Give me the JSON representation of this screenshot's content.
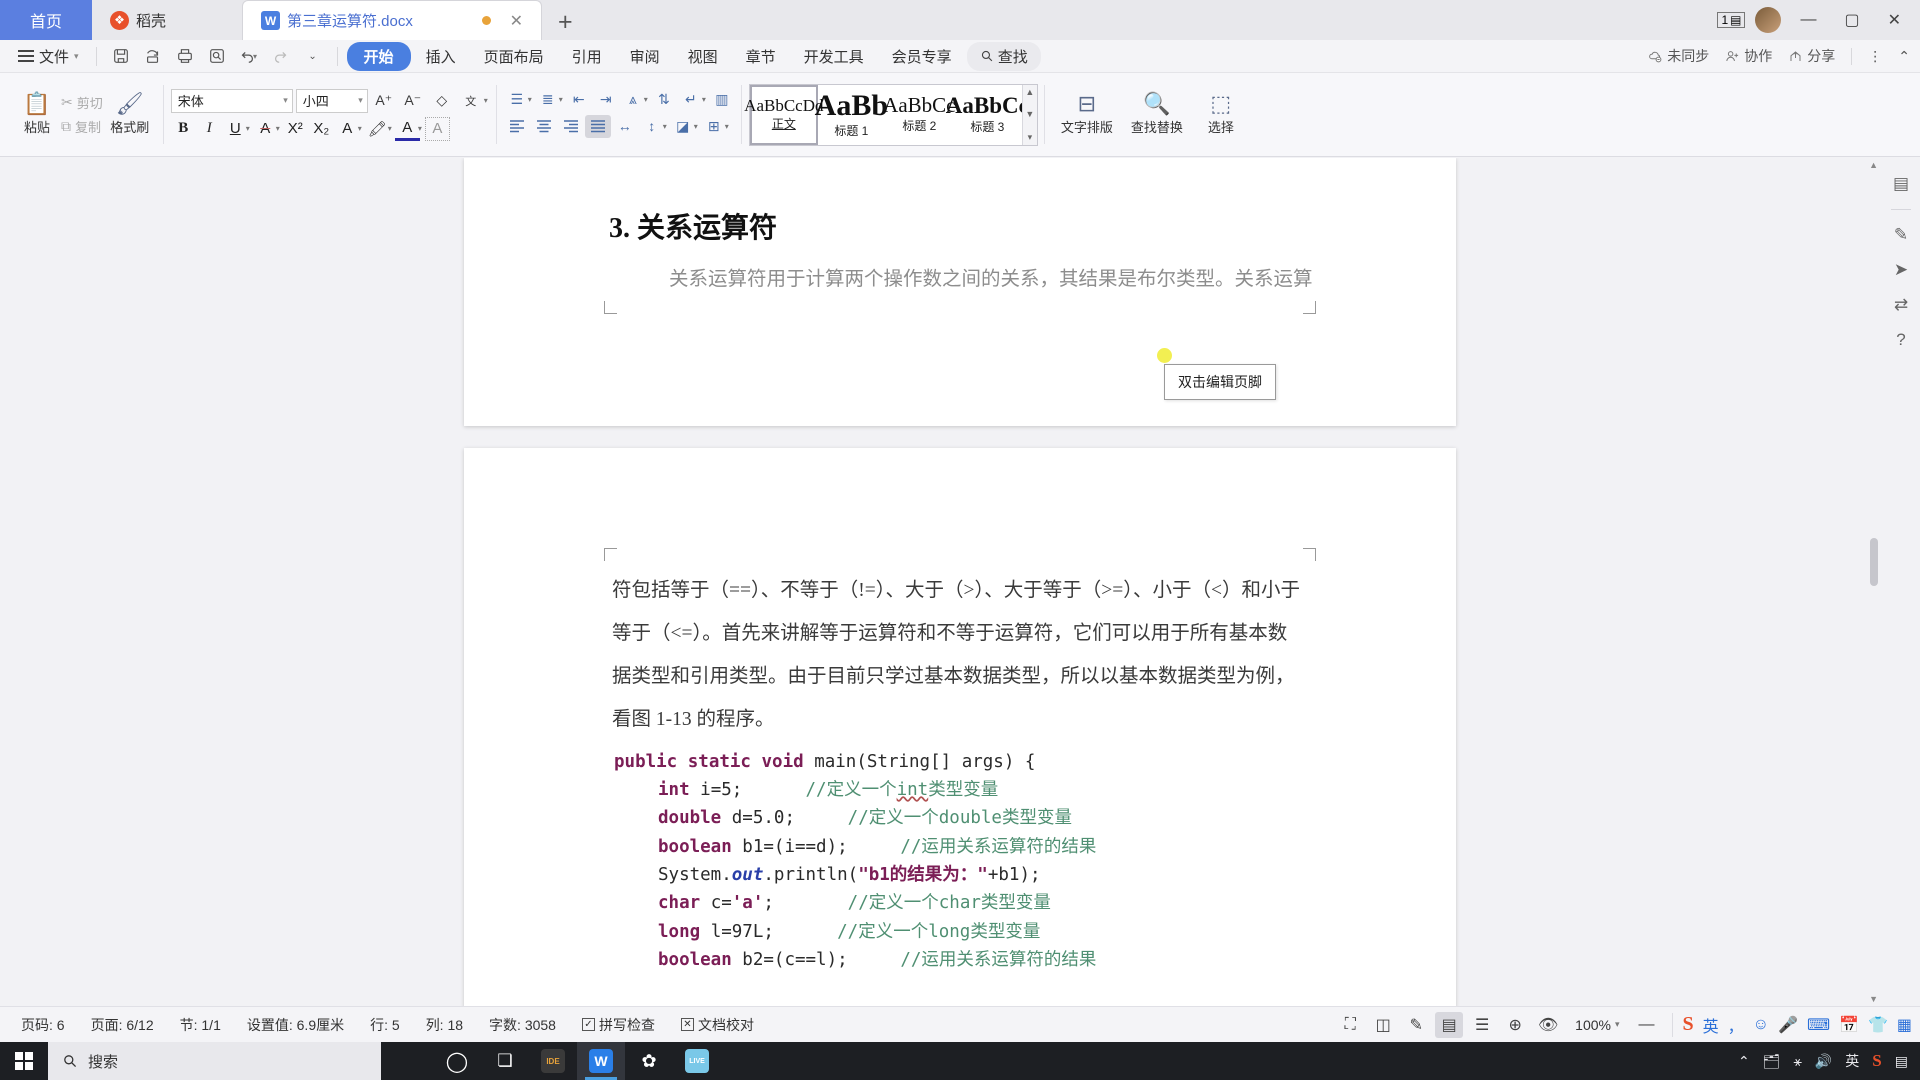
{
  "window": {
    "tabs": [
      {
        "label": "首页",
        "icon": "home-tab"
      },
      {
        "label": "稻壳",
        "icon": "daoke-icon"
      },
      {
        "label": "第三章运算符.docx",
        "icon": "word-doc-icon"
      }
    ],
    "new_tab": "+",
    "badge": "1",
    "minimize": "—",
    "maximize": "▢",
    "close": "✕"
  },
  "menubar": {
    "file": "文件",
    "quick_icons": [
      "save-icon",
      "print-preview-icon",
      "print-icon",
      "find-doc-icon",
      "undo-icon",
      "redo-icon",
      "customize-icon"
    ],
    "tabs": [
      "开始",
      "插入",
      "页面布局",
      "引用",
      "审阅",
      "视图",
      "章节",
      "开发工具",
      "会员专享"
    ],
    "active_tab": "开始",
    "find": "查找",
    "right": {
      "sync": "未同步",
      "collaborate": "协作",
      "share": "分享",
      "more": "⋮",
      "collapse": "⌃"
    }
  },
  "ribbon": {
    "clipboard": {
      "paste": "粘贴",
      "cut": "剪切",
      "copy": "复制",
      "format_painter": "格式刷"
    },
    "font": {
      "family": "宋体",
      "size": "小四",
      "grow": "A⁺",
      "shrink": "A⁻",
      "clear_format": "clear-format-icon",
      "pinyin": "拼音指南",
      "bold": "B",
      "italic": "I",
      "underline": "U",
      "strikethrough": "A",
      "superscript": "X²",
      "subscript": "X₂",
      "char_border": "A",
      "highlight": "highlight-icon",
      "font_color": "A",
      "char_shading": "char-shading-icon"
    },
    "paragraph": {
      "bullets": "bullet-list-icon",
      "numbering": "numbered-list-icon",
      "decrease_indent": "decrease-indent-icon",
      "increase_indent": "increase-indent-icon",
      "smart_layout": "smart-layout-icon",
      "sort": "sort-icon",
      "show_marks": "show-marks-icon",
      "ruler": "ruler-icon",
      "align_left": "align-left-icon",
      "align_center": "align-center-icon",
      "align_right": "align-right-icon",
      "align_justify": "align-justify-icon",
      "distribute": "distribute-icon",
      "line_spacing": "line-spacing-icon",
      "shading": "shading-icon",
      "borders": "borders-icon",
      "active": "align-justify-icon"
    },
    "styles": [
      {
        "preview": "AaBbCcDd",
        "label": "正文",
        "size": 17,
        "selected": true
      },
      {
        "preview": "AaBb",
        "label": "标题 1",
        "size": 30,
        "bold": true,
        "selected": false
      },
      {
        "preview": "AaBbCc",
        "label": "标题 2",
        "size": 21,
        "selected": false
      },
      {
        "preview": "AaBbCc",
        "label": "标题 3",
        "size": 23,
        "bold": true,
        "selected": false
      }
    ],
    "tools": {
      "text_layout": "文字排版",
      "find_replace": "查找替换",
      "select": "选择"
    }
  },
  "document": {
    "heading": "3. 关系运算符",
    "page1_paragraph": "关系运算符用于计算两个操作数之间的关系，其结果是布尔类型。关系运算",
    "footer_tooltip": "双击编辑页脚",
    "page2_paragraphs": [
      "符包括等于（==）、不等于（!=）、大于（>）、大于等于（>=）、小于（<）和小于",
      "等于（<=）。首先来讲解等于运算符和不等于运算符，它们可以用于所有基本数",
      "据类型和引用类型。由于目前只学过基本数据类型，所以以基本数据类型为例，",
      "看图 1-13 的程序。"
    ],
    "code_lines": [
      {
        "indent": 0,
        "tokens": [
          {
            "t": "public static void ",
            "c": "kw"
          },
          {
            "t": "main(String[] args) {",
            "c": "ident"
          }
        ]
      },
      {
        "indent": 1,
        "tokens": [
          {
            "t": "int ",
            "c": "kw"
          },
          {
            "t": "i=5;      ",
            "c": "ident"
          },
          {
            "t": "//定义一个",
            "c": "cm"
          },
          {
            "t": "int",
            "c": "cm-sq"
          },
          {
            "t": "类型变量",
            "c": "cm"
          }
        ]
      },
      {
        "indent": 1,
        "tokens": [
          {
            "t": "double ",
            "c": "kw"
          },
          {
            "t": "d=5.0;     ",
            "c": "ident"
          },
          {
            "t": "//定义一个double类型变量",
            "c": "cm"
          }
        ]
      },
      {
        "indent": 1,
        "tokens": [
          {
            "t": "boolean ",
            "c": "kw"
          },
          {
            "t": "b1=(i==d);     ",
            "c": "ident"
          },
          {
            "t": "//运用关系运算符的结果",
            "c": "cm"
          }
        ]
      },
      {
        "indent": 1,
        "tokens": [
          {
            "t": "System.",
            "c": "ident"
          },
          {
            "t": "out",
            "c": "ital"
          },
          {
            "t": ".println(",
            "c": "ident"
          },
          {
            "t": "\"b1的结果为：\"",
            "c": "str"
          },
          {
            "t": "+b1);",
            "c": "ident"
          }
        ]
      },
      {
        "indent": 1,
        "tokens": [
          {
            "t": "char ",
            "c": "kw"
          },
          {
            "t": "c=",
            "c": "ident"
          },
          {
            "t": "'a'",
            "c": "str"
          },
          {
            "t": ";       ",
            "c": "ident"
          },
          {
            "t": "//定义一个char类型变量",
            "c": "cm"
          }
        ]
      },
      {
        "indent": 1,
        "tokens": [
          {
            "t": "long ",
            "c": "kw"
          },
          {
            "t": "l=97L;      ",
            "c": "ident"
          },
          {
            "t": "//定义一个long类型变量",
            "c": "cm"
          }
        ]
      },
      {
        "indent": 1,
        "tokens": [
          {
            "t": "boolean ",
            "c": "kw"
          },
          {
            "t": "b2=(c==l);     ",
            "c": "ident"
          },
          {
            "t": "//运用关系运算符的结果",
            "c": "cm"
          }
        ]
      }
    ]
  },
  "statusbar": {
    "page_number": "页码: 6",
    "pages": "页面: 6/12",
    "section": "节: 1/1",
    "setting": "设置值: 6.9厘米",
    "row": "行: 5",
    "col": "列: 18",
    "words": "字数: 3058",
    "spell_check": "拼写检查",
    "doc_proof": "文档校对",
    "view_icons": [
      "fullscreen-icon",
      "reading-layout-icon",
      "edit-layout-icon",
      "page-layout-icon",
      "outline-icon",
      "web-layout-icon",
      "eye-protect-icon"
    ],
    "active_view": "page-layout-icon",
    "zoom": "100%",
    "zoom_out": "—",
    "ime": [
      "sogou-icon",
      "英",
      "punctuation-icon",
      "emoji-icon",
      "mic-icon",
      "keyboard-icon",
      "calendar-icon",
      "skin-icon",
      "toolbox-icon"
    ]
  },
  "taskbar": {
    "start": "start-icon",
    "search_placeholder": "搜索",
    "apps": [
      {
        "name": "cortana-icon",
        "glyph": "◯"
      },
      {
        "name": "task-view-icon",
        "glyph": "❏"
      },
      {
        "name": "intellij-idea-icon",
        "glyph": "IDE"
      },
      {
        "name": "wps-office-icon",
        "glyph": "W",
        "active": true
      },
      {
        "name": "settings-icon",
        "glyph": "✿"
      },
      {
        "name": "live-app-icon",
        "glyph": "LIVE"
      }
    ],
    "tray": [
      "chevron-up-icon",
      "folder-icon",
      "network-icon",
      "volume-icon",
      "ime-en-icon",
      "sogou-icon",
      "notification-icon"
    ],
    "tray_labels": {
      "ime": "英"
    }
  },
  "colors": {
    "accent": "#4a7fe0",
    "home_tab": "#5b7fe0",
    "daoke": "#e8502a",
    "code_keyword": "#7b1e56",
    "code_comment": "#4f8f72",
    "code_italic": "#2a3fa8",
    "taskbar": "#1d1f23"
  }
}
